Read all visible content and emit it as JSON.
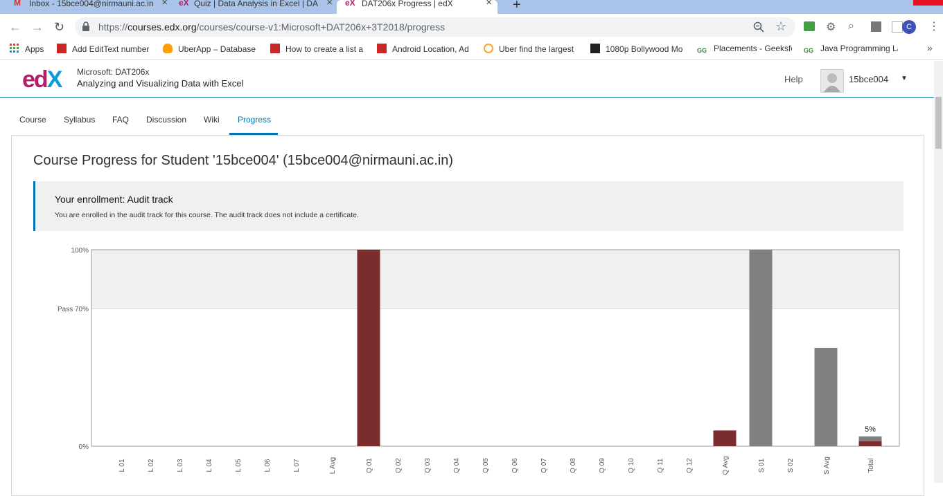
{
  "tabs": [
    {
      "title": "Inbox - 15bce004@nirmauni.ac.in",
      "icon": "gmail-icon"
    },
    {
      "title": "Quiz | Data Analysis in Excel | DA",
      "icon": "edx-icon"
    },
    {
      "title": "DAT206x Progress | edX",
      "icon": "edx-icon",
      "active": true
    }
  ],
  "new_tab_symbol": "+",
  "close_symbol": "×",
  "address": {
    "scheme": "https://",
    "host": "courses.edx.org",
    "path": "/courses/course-v1:Microsoft+DAT206x+3T2018/progress"
  },
  "profile_initial": "C",
  "bookmarks": [
    {
      "label": "Apps",
      "color": "#e53935"
    },
    {
      "label": "Add EditText number",
      "color": "#c62828"
    },
    {
      "label": "UberApp – Database",
      "color": "#ffa000"
    },
    {
      "label": "How to create a list a",
      "color": "#c62828"
    },
    {
      "label": "Android Location, Ad",
      "color": "#c62828"
    },
    {
      "label": "Uber find the largest",
      "color": "#f9a825"
    },
    {
      "label": "1080p Bollywood Mo",
      "color": "#222222"
    },
    {
      "label": "Placements - Geeksfo",
      "color": "#2e7d32"
    },
    {
      "label": "Java Programming La",
      "color": "#2e7d32"
    }
  ],
  "bookmarks_more": "»",
  "header": {
    "logo_text": "edX",
    "org": "Microsoft: DAT206x",
    "course": "Analyzing and Visualizing Data with Excel",
    "help": "Help",
    "username": "15bce004"
  },
  "nav": [
    "Course",
    "Syllabus",
    "FAQ",
    "Discussion",
    "Wiki",
    "Progress"
  ],
  "page": {
    "title": "Course Progress for Student '15bce004' (15bce004@nirmauni.ac.in)",
    "enroll_title": "Your enrollment: Audit track",
    "enroll_text": "You are enrolled in the audit track for this course. The audit track does not include a certificate."
  },
  "colors": {
    "earned": "#7b2c2c",
    "possible": "#808080",
    "accent": "#0075b4"
  },
  "chart_data": {
    "type": "bar",
    "categories": [
      "L 01",
      "L 02",
      "L 03",
      "L 04",
      "L 05",
      "L 06",
      "L 07",
      "L Avg",
      "Q 01",
      "Q 02",
      "Q 03",
      "Q 04",
      "Q 05",
      "Q 06",
      "Q 07",
      "Q 08",
      "Q 09",
      "Q 10",
      "Q 11",
      "Q 12",
      "Q Avg",
      "S 01",
      "S 02",
      "S Avg",
      "Total"
    ],
    "series": [
      {
        "values": [
          0,
          0,
          0,
          0,
          0,
          0,
          0,
          0,
          100,
          0,
          0,
          0,
          0,
          0,
          0,
          0,
          0,
          0,
          0,
          0,
          8,
          0,
          0,
          0,
          2.5
        ]
      },
      {
        "values": [
          0,
          0,
          0,
          0,
          0,
          0,
          0,
          0,
          0,
          0,
          0,
          0,
          0,
          0,
          0,
          0,
          0,
          0,
          0,
          0,
          0,
          100,
          0,
          50,
          5
        ]
      }
    ],
    "yticks": [
      {
        "value": 100,
        "label": "100%"
      },
      {
        "value": 70,
        "label": "Pass 70%"
      },
      {
        "value": 0,
        "label": "0%"
      }
    ],
    "ylim": [
      0,
      100
    ],
    "pass_band": [
      70,
      100
    ],
    "annotation": {
      "category": "Total",
      "label": "5%"
    }
  }
}
